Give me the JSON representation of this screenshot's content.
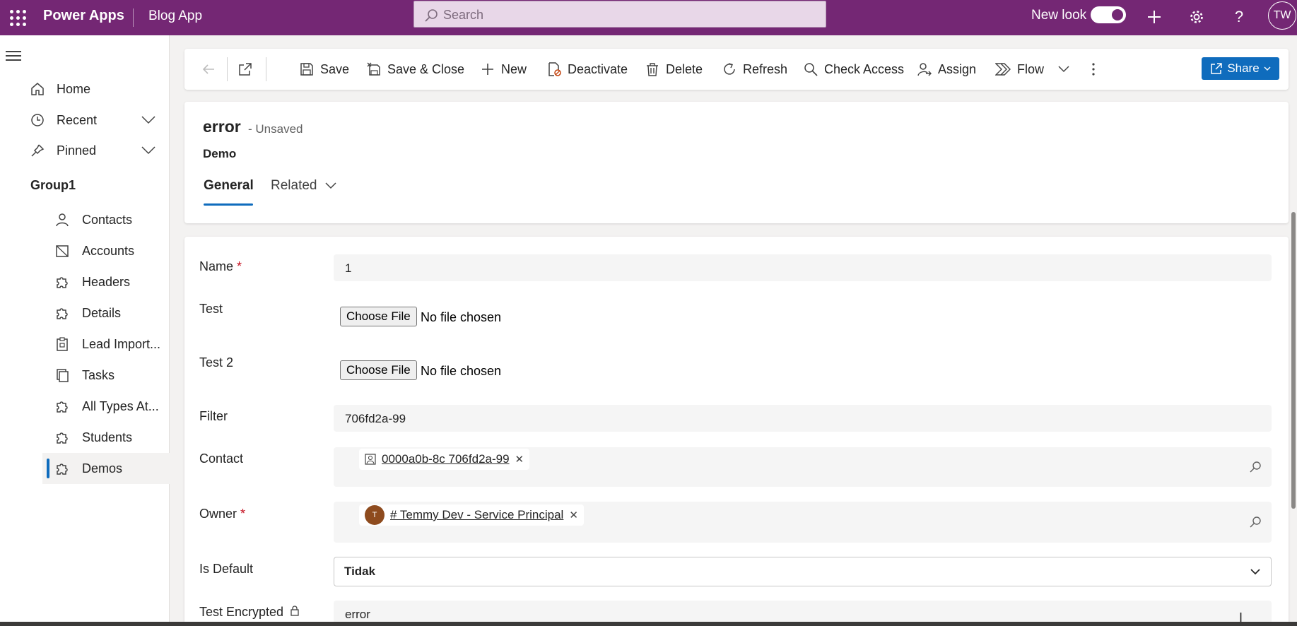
{
  "topbar": {
    "brand": "Power Apps",
    "app_name": "Blog App",
    "search_placeholder": "Search",
    "new_look_label": "New look",
    "user_initials": "TW"
  },
  "sidebar": {
    "items": [
      {
        "label": "Home",
        "icon": "home-icon"
      },
      {
        "label": "Recent",
        "icon": "clock-icon"
      },
      {
        "label": "Pinned",
        "icon": "pin-icon"
      }
    ],
    "group_title": "Group1",
    "group_items": [
      {
        "label": "Contacts",
        "icon": "person-icon"
      },
      {
        "label": "Accounts",
        "icon": "accounts-icon"
      },
      {
        "label": "Headers",
        "icon": "puzzle-icon"
      },
      {
        "label": "Details",
        "icon": "puzzle-icon"
      },
      {
        "label": "Lead Import...",
        "icon": "clipboard-icon"
      },
      {
        "label": "Tasks",
        "icon": "tasks-icon"
      },
      {
        "label": "All Types At...",
        "icon": "puzzle-icon"
      },
      {
        "label": "Students",
        "icon": "puzzle-icon"
      },
      {
        "label": "Demos",
        "icon": "puzzle-icon",
        "active": true
      }
    ]
  },
  "commandbar": {
    "save": "Save",
    "save_close": "Save & Close",
    "new": "New",
    "deactivate": "Deactivate",
    "delete": "Delete",
    "refresh": "Refresh",
    "check_access": "Check Access",
    "assign": "Assign",
    "flow": "Flow",
    "share": "Share"
  },
  "record": {
    "title": "error",
    "status": "- Unsaved",
    "entity": "Demo",
    "tabs": [
      "General",
      "Related"
    ]
  },
  "form": {
    "name_label": "Name",
    "name_value": "1",
    "test_label": "Test",
    "test2_label": "Test 2",
    "choose_file": "Choose File",
    "no_file": "No file chosen",
    "filter_label": "Filter",
    "filter_value": "706fd2a-99",
    "contact_label": "Contact",
    "contact_value": "0000a0b-8c 706fd2a-99",
    "owner_label": "Owner",
    "owner_initial": "T",
    "owner_value": "# Temmy Dev - Service Principal",
    "is_default_label": "Is Default",
    "is_default_value": "Tidak",
    "test_encrypted_label": "Test Encrypted",
    "test_encrypted_value": "error",
    "required_mark": "*"
  },
  "colors": {
    "topbar": "#742774",
    "accent": "#0f6cbd",
    "required": "#c50f1f"
  }
}
